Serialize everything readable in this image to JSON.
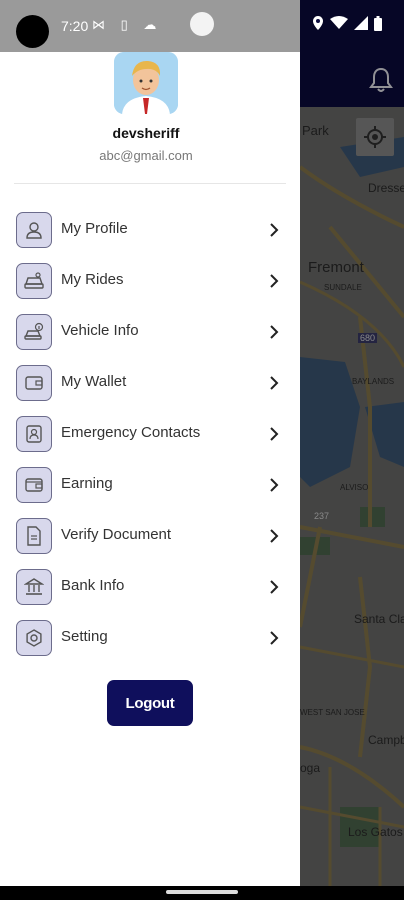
{
  "status_bar": {
    "time": "7:20",
    "left_icons": "⋈ ▯ ☁"
  },
  "user": {
    "name": "devsheriff",
    "email": "abc@gmail.com"
  },
  "menu": {
    "items": [
      {
        "label": "My Profile",
        "icon": "person-icon"
      },
      {
        "label": "My Rides",
        "icon": "car-icon"
      },
      {
        "label": "Vehicle Info",
        "icon": "vehicle-info-icon"
      },
      {
        "label": "My Wallet",
        "icon": "wallet-icon"
      },
      {
        "label": "Emergency Contacts",
        "icon": "contact-card-icon"
      },
      {
        "label": "Earning",
        "icon": "earning-wallet-icon"
      },
      {
        "label": "Verify Document",
        "icon": "document-icon"
      },
      {
        "label": "Bank Info",
        "icon": "bank-icon"
      },
      {
        "label": "Setting",
        "icon": "gear-icon"
      }
    ]
  },
  "logout_label": "Logout",
  "map": {
    "labels": [
      "Park",
      "Dresse",
      "Fremont",
      "SUNDALE",
      "680",
      "BAYLANDS",
      "ALVISO",
      "237",
      "Santa Cla",
      "WEST SAN JOSE",
      "Campb",
      "Los Gatos",
      "oga"
    ]
  },
  "colors": {
    "appbar": "#0b0b3e",
    "accent": "#0f0f5c",
    "icon_bg": "#d8d8ec"
  }
}
